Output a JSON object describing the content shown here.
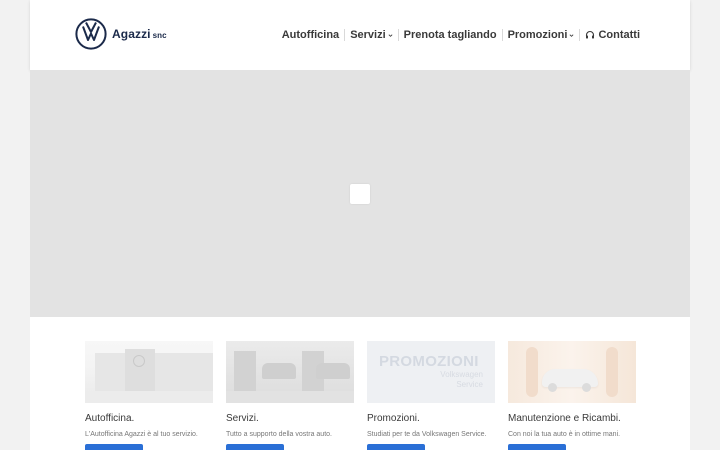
{
  "brand": {
    "name": "Agazzi",
    "suffix": "snc",
    "logo_icon": "vw-logo-icon",
    "brand_color": "#1b2a4a"
  },
  "nav": {
    "items": [
      {
        "label": "Autofficina",
        "has_dropdown": false
      },
      {
        "label": "Servizi",
        "has_dropdown": true
      },
      {
        "label": "Prenota tagliando",
        "has_dropdown": false
      },
      {
        "label": "Promozioni",
        "has_dropdown": true
      },
      {
        "label": "Contatti",
        "has_dropdown": false,
        "icon": "headset-icon"
      }
    ]
  },
  "hero": {
    "state": "loading",
    "loader_icon": "loading-spinner-icon"
  },
  "cards": [
    {
      "title": "Autofficina.",
      "text": "L'Autofficina Agazzi è al tuo servizio.",
      "image": "workshop-building-photo"
    },
    {
      "title": "Servizi.",
      "text": "Tutto a supporto della vostra auto.",
      "image": "service-bay-photo"
    },
    {
      "title": "Promozioni.",
      "text": "Studiati per te da Volkswagen Service.",
      "image": "promozioni-banner",
      "image_text_1": "PROMOZIONI",
      "image_text_2": "Volkswagen Service"
    },
    {
      "title": "Manutenzione e Ricambi.",
      "text": "Con noi la tua auto è in ottime mani.",
      "image": "car-in-hands-photo"
    }
  ],
  "colors": {
    "accent_button": "#2a6fd6",
    "nav_text": "#3a3a3a",
    "hero_background": "#e3e3e3"
  }
}
